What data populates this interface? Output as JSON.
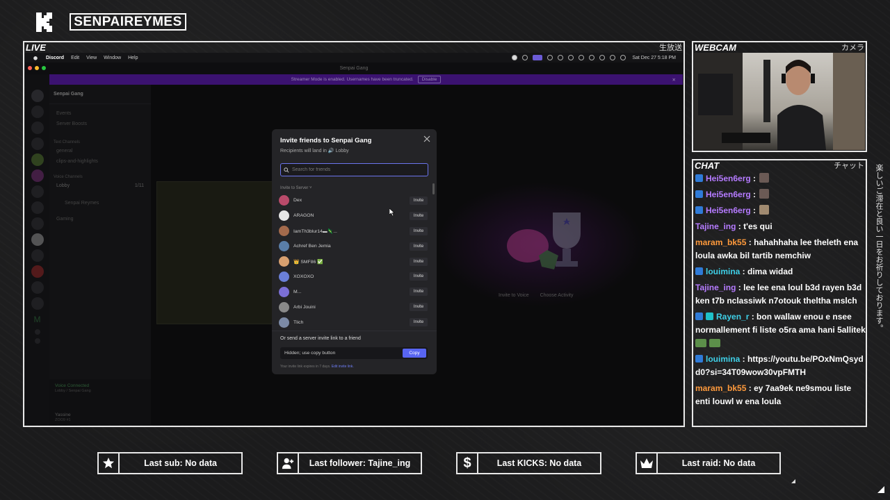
{
  "channel": {
    "name": "SENPAIREYMES"
  },
  "live_panel": {
    "label": "LIVE",
    "jp": "生放送"
  },
  "webcam_panel": {
    "label": "WEBCAM",
    "jp": "カメラ"
  },
  "chat_panel": {
    "label": "CHAT",
    "jp": "チャット"
  },
  "side_text": "楽しいご滞在と良い一日をお祈りしております。",
  "menubar": {
    "app": "Discord",
    "items": [
      "Edit",
      "View",
      "Window",
      "Help"
    ],
    "datetime": "Sat Dec 27  5:18 PM"
  },
  "window_title": "Senpai Gang",
  "streamer_notice": {
    "text": "Streamer Mode is enabled. Usernames have been truncated.",
    "button": "Disable"
  },
  "server": {
    "name": "Senpai Gang",
    "channels": [
      "Events",
      "Server Boosts"
    ],
    "text_category": "Text Channels",
    "text_channels": [
      "general",
      "clips-and-highlights"
    ],
    "voice_category": "Voice Channels",
    "voice_channel": "Lobby",
    "voice_count": "1/11",
    "voice_user": "Senpai Reymes",
    "voice_channel_2": "Gaming"
  },
  "voice_status": {
    "title": "Voice Connected",
    "sub": "Lobby / Senpai Gang"
  },
  "user": {
    "name": "Yassine",
    "tag": "ZOO9 #1"
  },
  "voice_actions": {
    "invite": "Invite to Voice",
    "activity": "Choose Activity"
  },
  "modal": {
    "title": "Invite friends to Senpai Gang",
    "subtitle": "Recipients will land in 🔊 Lobby",
    "search_placeholder": "Search for friends",
    "section_label": "Invite to Server ˅",
    "invite_label": "Invite",
    "friends": [
      {
        "name": "Dex",
        "color": "#b94a6a"
      },
      {
        "name": "ARAGON",
        "color": "#e6e6e6"
      },
      {
        "name": "IamTh3blur14▬🦎...",
        "color": "#a36a4c"
      },
      {
        "name": "Achref Ben Jemia",
        "color": "#5a7ea8"
      },
      {
        "name": "👑 SMF86 ✅",
        "color": "#d8a070"
      },
      {
        "name": "XOXOXO",
        "color": "#6a7fd8"
      },
      {
        "name": "M...",
        "color": "#7b6fd6"
      },
      {
        "name": "Arbi Jouini",
        "color": "#8a8a8a"
      },
      {
        "name": "Tlich",
        "color": "#7c8aa6"
      }
    ],
    "link_label": "Or send a server invite link to a friend",
    "link_value": "Hidden; use copy button",
    "copy_label": "Copy",
    "expire_text": "Your invite link expires in 7 days. ",
    "expire_link": "Edit invite link."
  },
  "chat": [
    {
      "user": "Hei5en6erg",
      "color": "purple",
      "text": "",
      "platform": "kick",
      "emote": true
    },
    {
      "user": "Hei5en6erg",
      "color": "purple",
      "text": "",
      "platform": "kick",
      "emote": true
    },
    {
      "user": "Hei5en6erg",
      "color": "purple",
      "text": "",
      "platform": "kick",
      "emote": true
    },
    {
      "user": "Tajine_ing",
      "color": "purple",
      "text": "t'es qui",
      "platform": ""
    },
    {
      "user": "maram_bk55",
      "color": "orange",
      "text": "hahahhaha lee theleth ena loula awka bil tartib nemchiw",
      "platform": ""
    },
    {
      "user": "louimina",
      "color": "cyan",
      "text": "dima widad",
      "platform": "kick"
    },
    {
      "user": "Tajine_ing",
      "color": "purple",
      "text": "lee lee ena loul b3d rayen b3d ken t7b nclassiwk n7otouk theltha mslch",
      "platform": ""
    },
    {
      "user": "Rayen_r",
      "color": "cyan",
      "text": "bon wallaw enou e nsee normallement fi liste o5ra ama hani 5allitek",
      "platform": "kick2",
      "money": true
    },
    {
      "user": "louimina",
      "color": "cyan",
      "text": "https://youtu.be/POxNmQsydd0?si=34T09wow30vpFMTH",
      "platform": "kick"
    },
    {
      "user": "maram_bk55",
      "color": "orange",
      "text": "ey 7aa9ek ne9smou liste enti louwl w ena loula",
      "platform": ""
    }
  ],
  "stats": {
    "sub": "Last sub: No data",
    "follower": "Last follower: Tajine_ing",
    "kicks": "Last KICKS: No data",
    "raid": "Last raid: No data"
  }
}
